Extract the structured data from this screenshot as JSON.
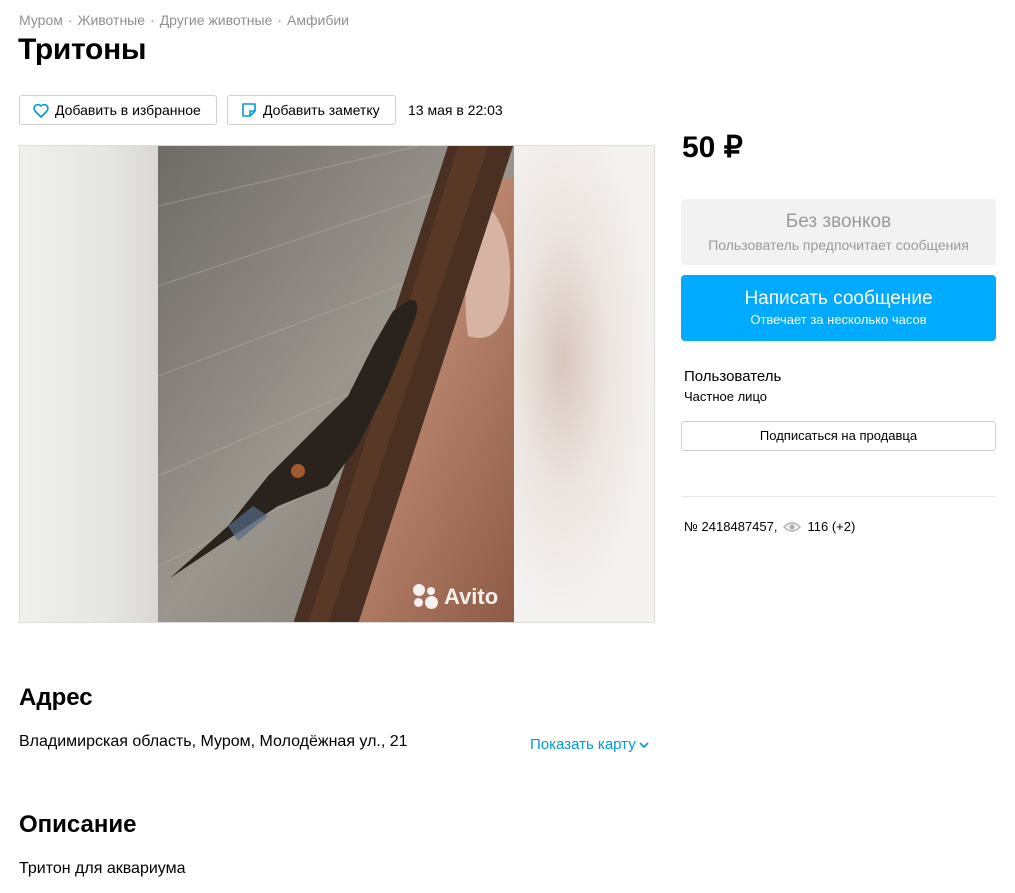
{
  "breadcrumbs": [
    "Муром",
    "Животные",
    "Другие животные",
    "Амфибии"
  ],
  "breadcrumb_separator": "·",
  "title": "Тритоны",
  "actions": {
    "favorite_label": "Добавить в избранное",
    "note_label": "Добавить заметку",
    "date": "13 мая в 22:03"
  },
  "gallery": {
    "watermark": "Avito"
  },
  "price": "50 ₽",
  "contact": {
    "no_calls_title": "Без звонков",
    "no_calls_subtitle": "Пользователь предпочитает сообщения",
    "message_title": "Написать сообщение",
    "message_subtitle": "Отвечает за несколько часов"
  },
  "seller": {
    "name": "Пользователь",
    "type": "Частное лицо",
    "subscribe_label": "Подписаться на продавца"
  },
  "meta": {
    "ad_number": "№ 2418487457,",
    "views": "116 (+2)"
  },
  "address": {
    "heading": "Адрес",
    "text": "Владимирская область, Муром, Молодёжная ул., 21",
    "map_link": "Показать карту"
  },
  "description": {
    "heading": "Описание",
    "text": "Тритон для аквариума"
  },
  "colors": {
    "accent": "#00aaff",
    "link": "#0099dd",
    "muted": "#8f8f8f"
  },
  "icons": [
    "heart-icon",
    "note-icon",
    "eye-icon",
    "chevron-down-icon",
    "avito-logo-icon"
  ]
}
